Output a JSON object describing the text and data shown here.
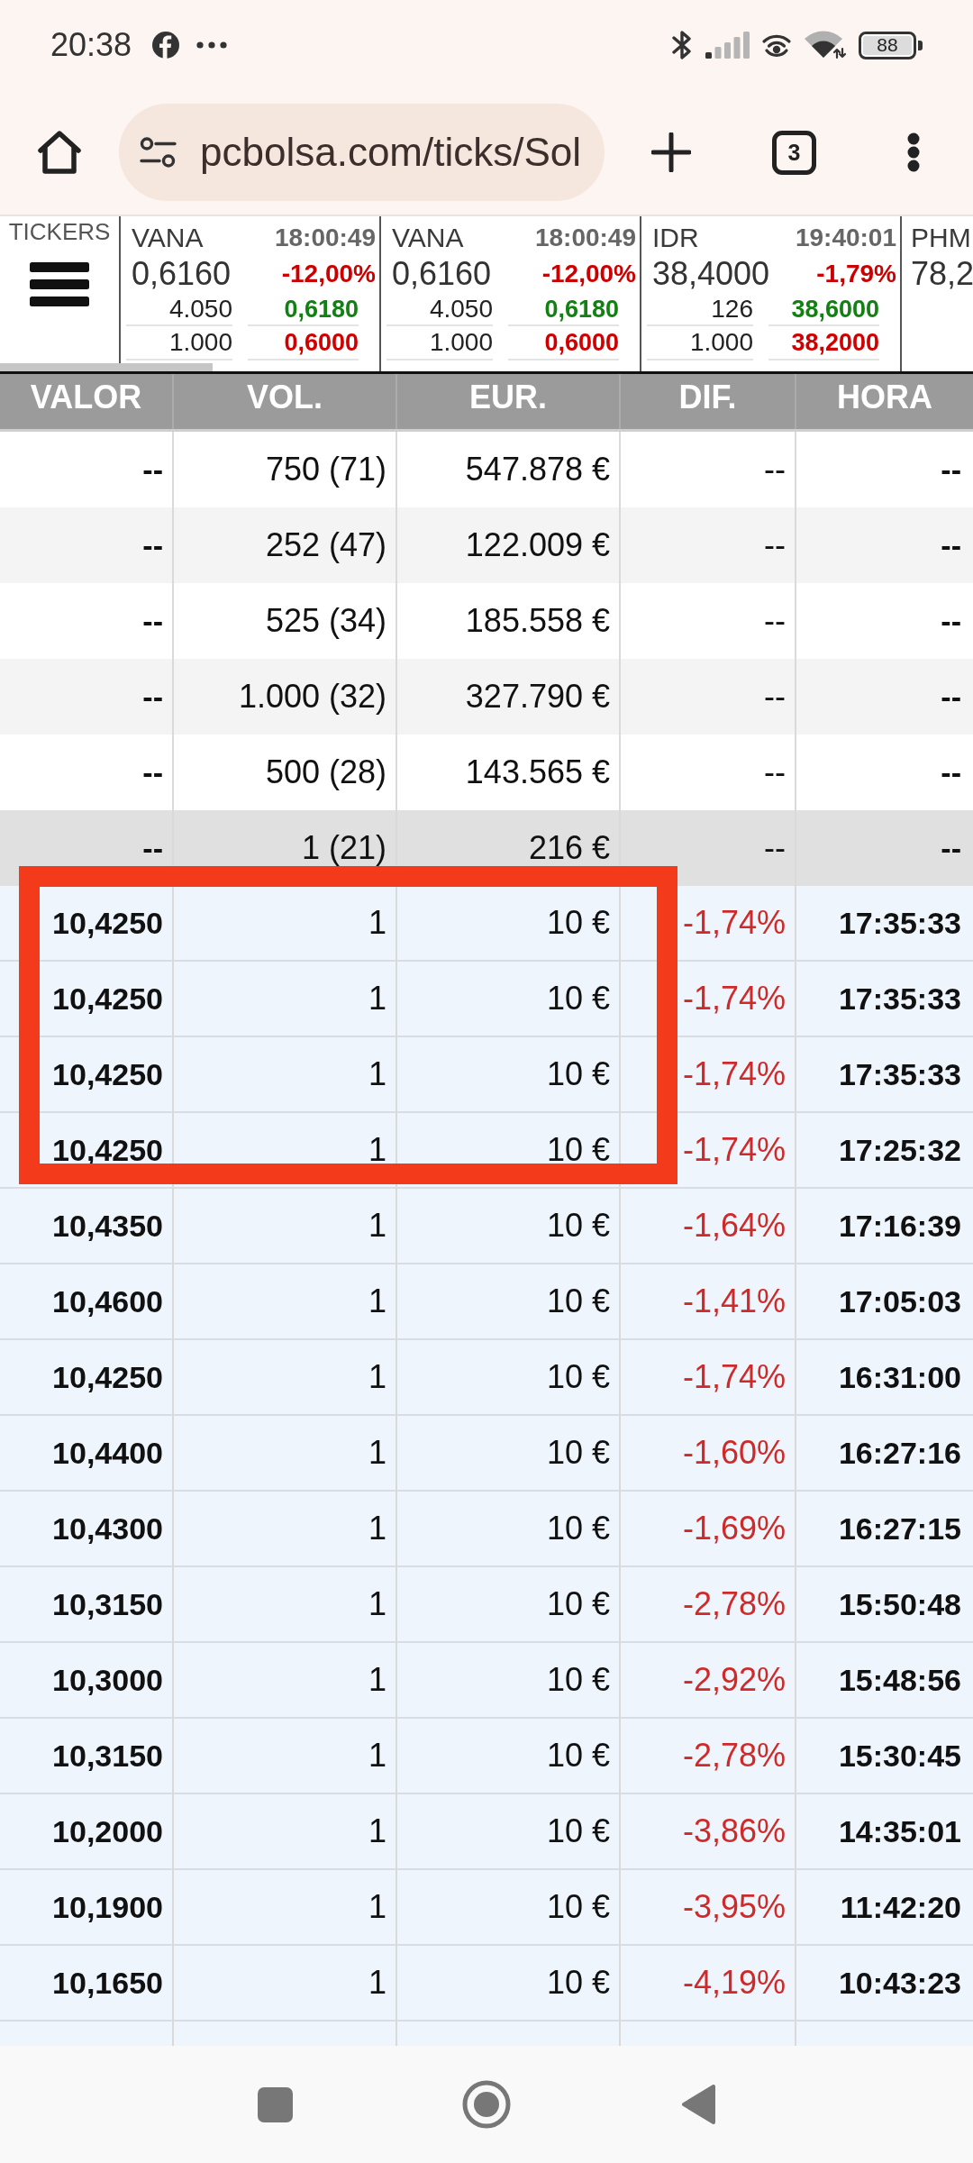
{
  "status_bar": {
    "time": "20:38",
    "battery": "88"
  },
  "browser": {
    "url": "pcbolsa.com/ticks/Sol",
    "tab_count": "3"
  },
  "tickers": {
    "label": "TICKERS",
    "cards": [
      {
        "symbol": "VANA",
        "time": "18:00:49",
        "price": "0,6160",
        "change": "-12,00%",
        "bid": {
          "volume": "4.050",
          "price": "0,6180"
        },
        "ask": {
          "volume": "1.000",
          "price": "0,6000"
        }
      },
      {
        "symbol": "VANA",
        "time": "18:00:49",
        "price": "0,6160",
        "change": "-12,00%",
        "bid": {
          "volume": "4.050",
          "price": "0,6180"
        },
        "ask": {
          "volume": "1.000",
          "price": "0,6000"
        }
      },
      {
        "symbol": "IDR",
        "time": "19:40:01",
        "price": "38,4000",
        "change": "-1,79%",
        "bid": {
          "volume": "126",
          "price": "38,6000"
        },
        "ask": {
          "volume": "1.000",
          "price": "38,2000"
        }
      },
      {
        "symbol": "PHM",
        "price": "78,2"
      }
    ]
  },
  "table": {
    "columns": [
      "VALOR",
      "VOL.",
      "EUR.",
      "DIF.",
      "HORA"
    ],
    "summary_rows": [
      {
        "valor": "--",
        "vol": "750 (71)",
        "eur": "547.878 €",
        "dif": "--",
        "hora": "--",
        "highlighted": false
      },
      {
        "valor": "--",
        "vol": "252 (47)",
        "eur": "122.009 €",
        "dif": "--",
        "hora": "--",
        "highlighted": false
      },
      {
        "valor": "--",
        "vol": "525 (34)",
        "eur": "185.558 €",
        "dif": "--",
        "hora": "--",
        "highlighted": false
      },
      {
        "valor": "--",
        "vol": "1.000 (32)",
        "eur": "327.790 €",
        "dif": "--",
        "hora": "--",
        "highlighted": false
      },
      {
        "valor": "--",
        "vol": "500 (28)",
        "eur": "143.565 €",
        "dif": "--",
        "hora": "--",
        "highlighted": false
      },
      {
        "valor": "--",
        "vol": "1 (21)",
        "eur": "216 €",
        "dif": "--",
        "hora": "--",
        "highlighted": true
      }
    ],
    "tick_rows": [
      {
        "valor": "10,4250",
        "vol": "1",
        "eur": "10 €",
        "dif": "-1,74%",
        "hora": "17:35:33",
        "boxed": true
      },
      {
        "valor": "10,4250",
        "vol": "1",
        "eur": "10 €",
        "dif": "-1,74%",
        "hora": "17:35:33",
        "boxed": true
      },
      {
        "valor": "10,4250",
        "vol": "1",
        "eur": "10 €",
        "dif": "-1,74%",
        "hora": "17:35:33",
        "boxed": true
      },
      {
        "valor": "10,4250",
        "vol": "1",
        "eur": "10 €",
        "dif": "-1,74%",
        "hora": "17:25:32",
        "boxed": true
      },
      {
        "valor": "10,4350",
        "vol": "1",
        "eur": "10 €",
        "dif": "-1,64%",
        "hora": "17:16:39",
        "boxed": false
      },
      {
        "valor": "10,4600",
        "vol": "1",
        "eur": "10 €",
        "dif": "-1,41%",
        "hora": "17:05:03",
        "boxed": false
      },
      {
        "valor": "10,4250",
        "vol": "1",
        "eur": "10 €",
        "dif": "-1,74%",
        "hora": "16:31:00",
        "boxed": false
      },
      {
        "valor": "10,4400",
        "vol": "1",
        "eur": "10 €",
        "dif": "-1,60%",
        "hora": "16:27:16",
        "boxed": false
      },
      {
        "valor": "10,4300",
        "vol": "1",
        "eur": "10 €",
        "dif": "-1,69%",
        "hora": "16:27:15",
        "boxed": false
      },
      {
        "valor": "10,3150",
        "vol": "1",
        "eur": "10 €",
        "dif": "-2,78%",
        "hora": "15:50:48",
        "boxed": false
      },
      {
        "valor": "10,3000",
        "vol": "1",
        "eur": "10 €",
        "dif": "-2,92%",
        "hora": "15:48:56",
        "boxed": false
      },
      {
        "valor": "10,3150",
        "vol": "1",
        "eur": "10 €",
        "dif": "-2,78%",
        "hora": "15:30:45",
        "boxed": false
      },
      {
        "valor": "10,2000",
        "vol": "1",
        "eur": "10 €",
        "dif": "-3,86%",
        "hora": "14:35:01",
        "boxed": false
      },
      {
        "valor": "10,1900",
        "vol": "1",
        "eur": "10 €",
        "dif": "-3,95%",
        "hora": "11:42:20",
        "boxed": false
      },
      {
        "valor": "10,1650",
        "vol": "1",
        "eur": "10 €",
        "dif": "-4,19%",
        "hora": "10:43:23",
        "boxed": false
      }
    ]
  }
}
